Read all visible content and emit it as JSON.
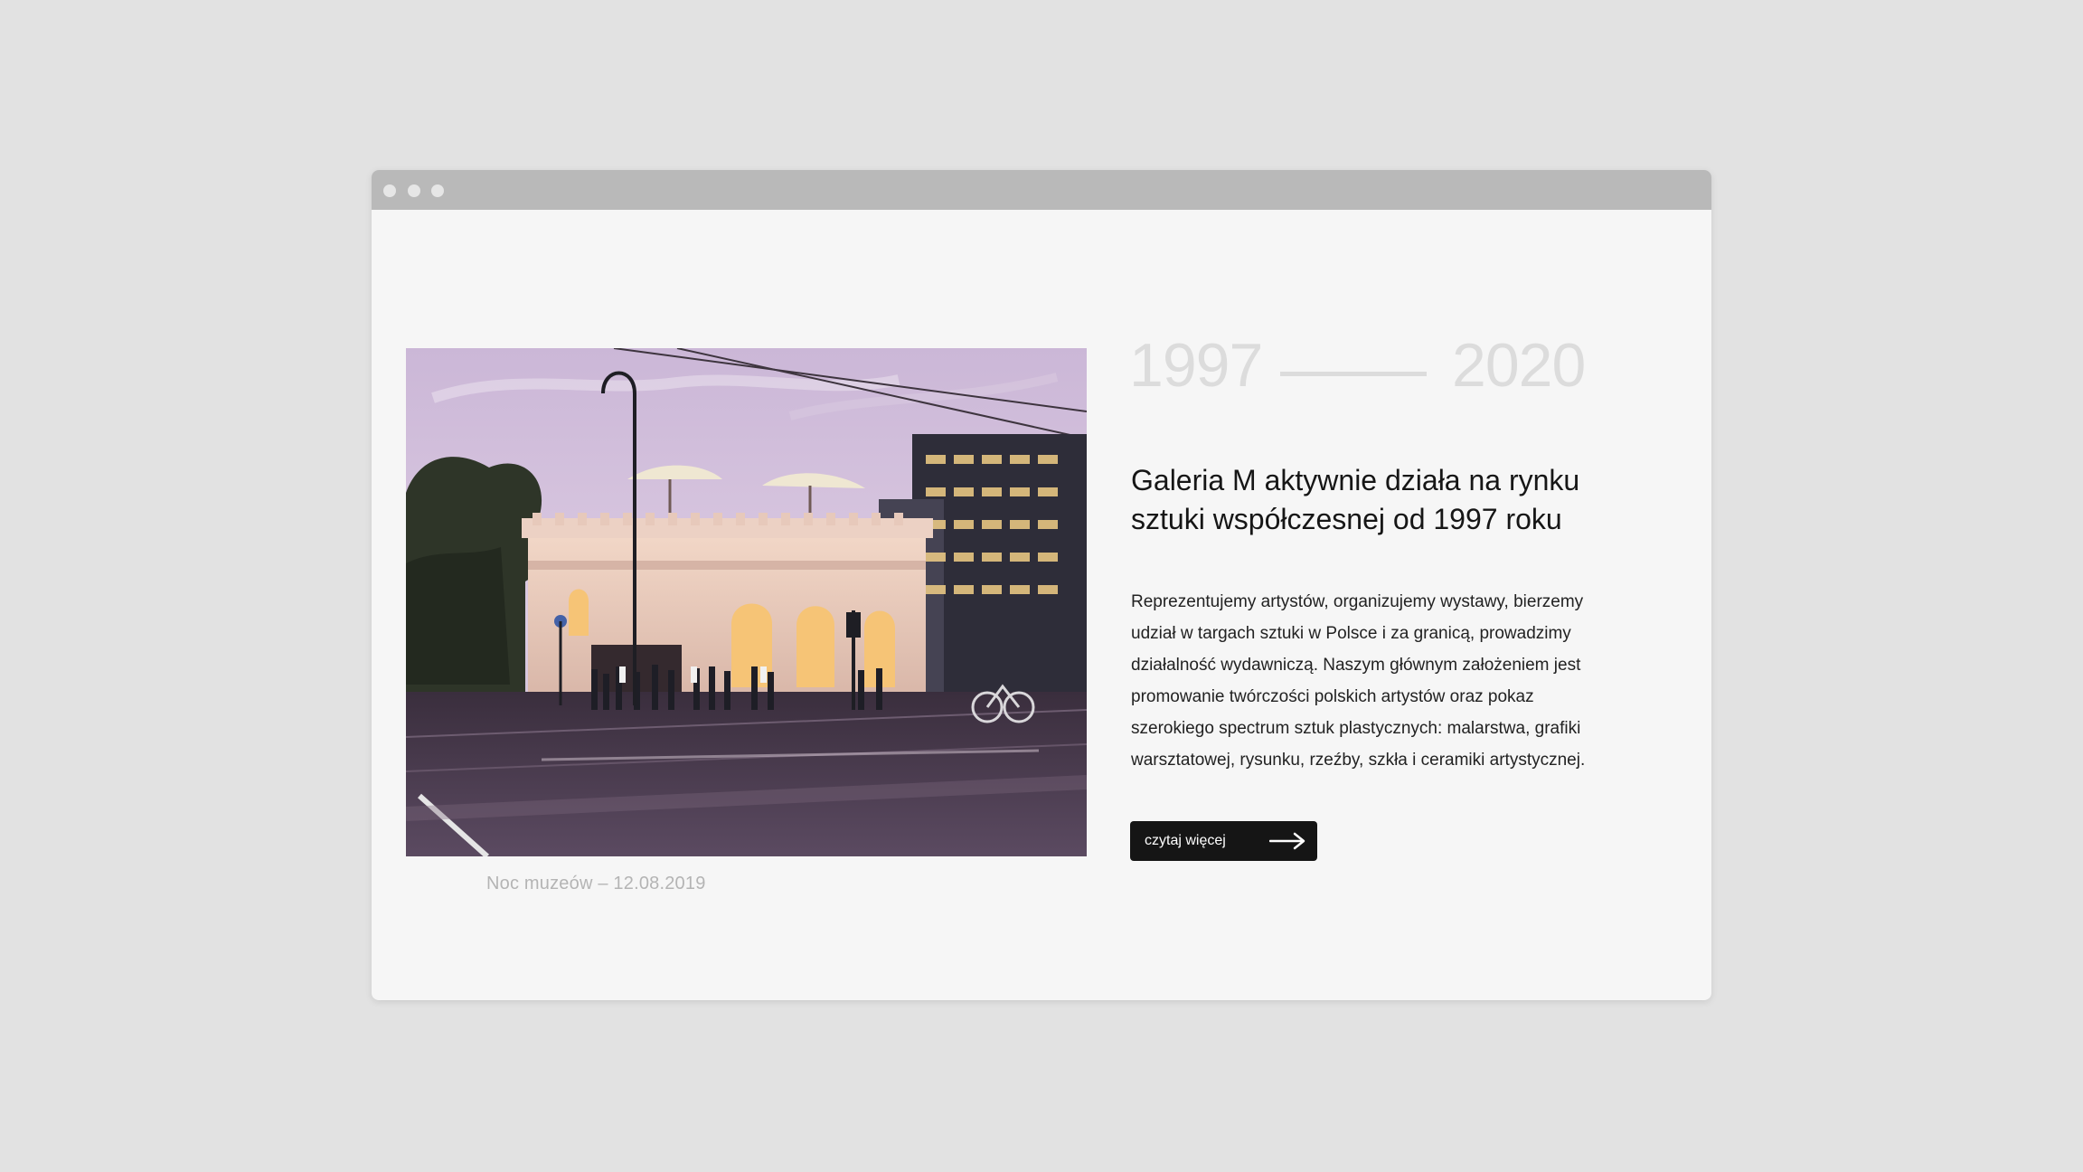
{
  "window": {
    "controls": [
      "window-dot",
      "window-dot",
      "window-dot"
    ]
  },
  "photo": {
    "alt": "",
    "caption": "Noc muzeów – 12.08.2019"
  },
  "timeline": {
    "start_year": "1997",
    "end_year": "2020"
  },
  "headline": "Galeria M aktywnie działa na rynku sztuki współczesnej od 1997 roku",
  "body": "Reprezentujemy artystów, organizujemy wystawy, bierzemy udział w targach sztuki w Polsce i za granicą, prowadzimy działalność wydawniczą. Naszym głównym założeniem jest promowanie twórczości polskich artystów oraz pokaz szerokiego spectrum sztuk plastycznych: malarstwa, grafiki warsztatowej, rysunku, rzeźby, szkła i ceramiki artystycznej.",
  "cta": {
    "label": "czytaj więcej",
    "icon": "arrow-right-icon"
  },
  "colors": {
    "background": "#e2e2e2",
    "window": "#f6f6f6",
    "titlebar": "#b9b9b9",
    "year": "#dcdcdc",
    "button": "#151515",
    "caption": "#b4b4b4"
  }
}
